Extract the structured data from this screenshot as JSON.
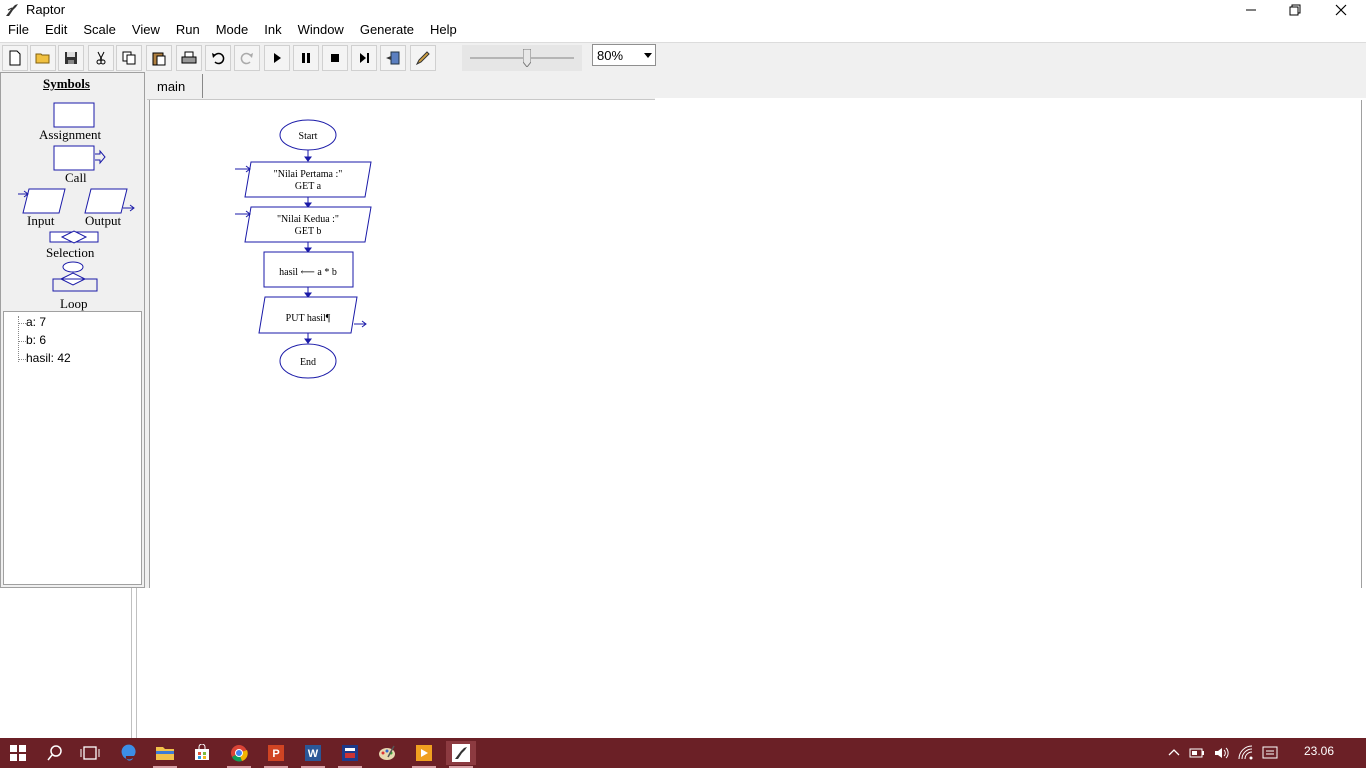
{
  "window": {
    "title": "Raptor"
  },
  "menu": [
    "File",
    "Edit",
    "Scale",
    "View",
    "Run",
    "Mode",
    "Ink",
    "Window",
    "Generate",
    "Help"
  ],
  "toolbar": {
    "buttons": [
      "new-file-icon",
      "open-folder-icon",
      "save-icon",
      "cut-icon",
      "copy-icon",
      "paste-icon",
      "print-icon",
      "undo-icon",
      "redo-icon",
      "play-icon",
      "pause-icon",
      "stop-icon",
      "step-icon",
      "test-server-icon",
      "pen-icon"
    ],
    "zoom_level": 0.55,
    "zoom_value": "80%"
  },
  "symbols": {
    "header": "Symbols",
    "items": [
      "Assignment",
      "Call",
      "Input",
      "Output",
      "Selection",
      "Loop"
    ]
  },
  "watch": [
    {
      "label": "a: 7"
    },
    {
      "label": "b: 6"
    },
    {
      "label": "hasil: 42"
    }
  ],
  "tabs": [
    {
      "label": "main"
    }
  ],
  "flowchart": {
    "start": "Start",
    "input1_line1": "\"Nilai Pertama :\"",
    "input1_line2": "GET a",
    "input2_line1": "\"Nilai Kedua :\"",
    "input2_line2": "GET b",
    "assignment": "hasil ⟵ a * b",
    "output": "PUT hasil¶",
    "end": "End"
  },
  "taskbar": {
    "apps": [
      "windows-start-icon",
      "search-icon",
      "task-view-icon",
      "edge-icon",
      "file-explorer-icon",
      "store-icon",
      "chrome-icon",
      "powerpoint-icon",
      "word-icon",
      "raptor-doc-icon",
      "paint-icon",
      "media-player-icon",
      "raptor-app-icon"
    ],
    "time": "23.06"
  },
  "colors": {
    "flow": "#1a1aa8",
    "taskbar": "#6b2026"
  }
}
